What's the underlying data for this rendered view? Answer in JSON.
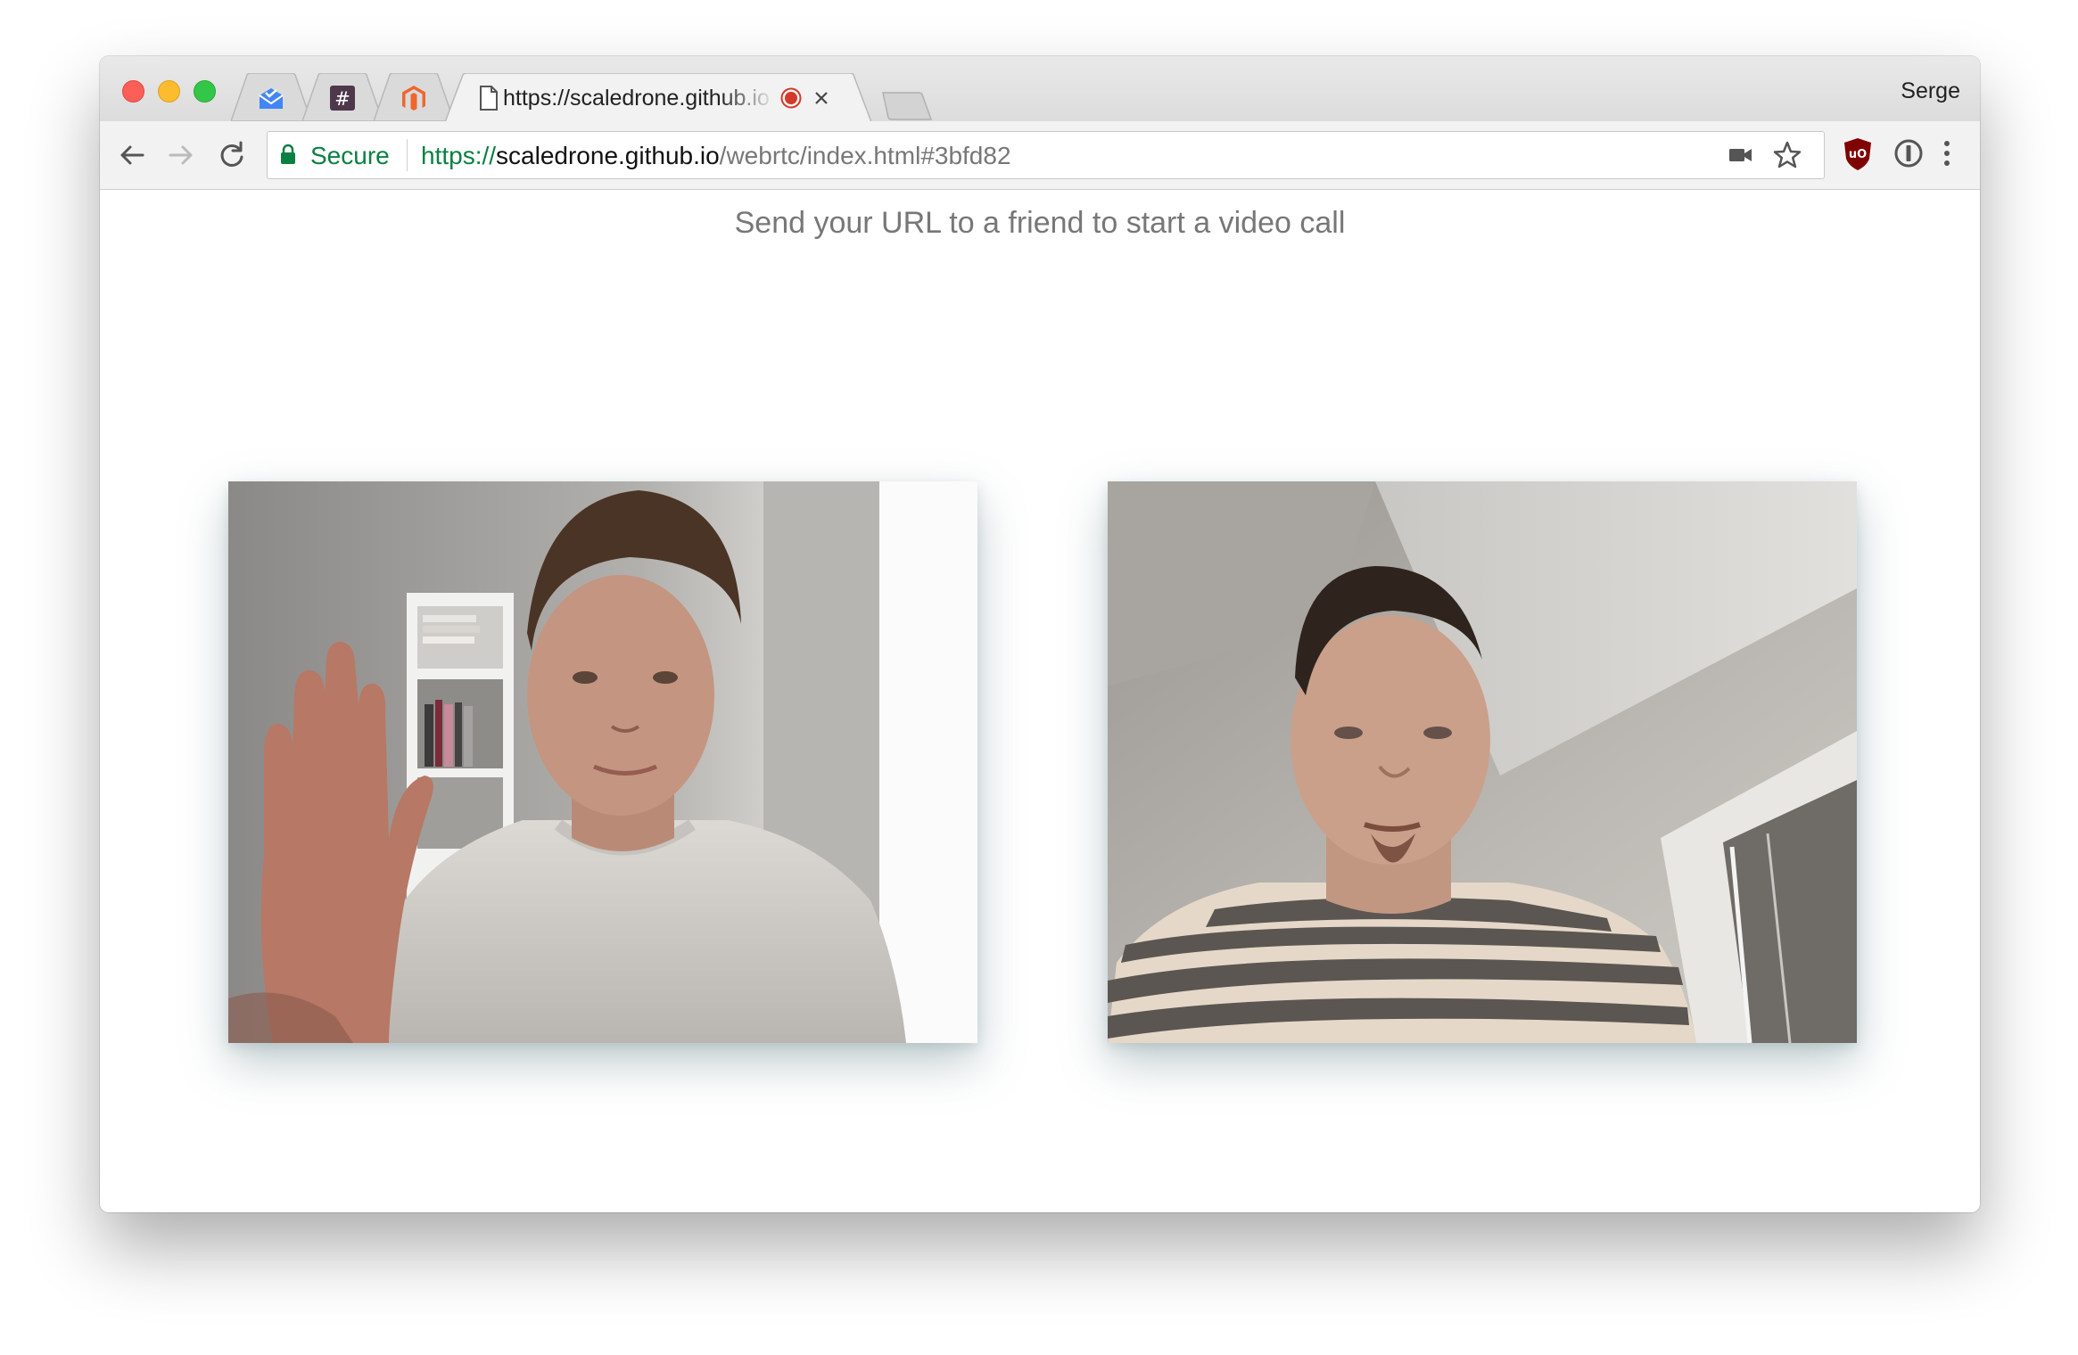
{
  "browser": {
    "profile_name": "Serge",
    "tabs": [
      {
        "icon": "inbox-envelope-icon",
        "pinned": true
      },
      {
        "icon": "slack-hash-icon",
        "pinned": true
      },
      {
        "icon": "magento-logo-icon",
        "pinned": true
      },
      {
        "title": "https://scaledrone.github.io",
        "icon": "page-icon",
        "recording": true,
        "active": true
      }
    ],
    "new_tab_label": ""
  },
  "toolbar": {
    "security_label": "Secure",
    "url": {
      "scheme": "https://",
      "host": "scaledrone.github.io",
      "path": "/webrtc/index.html#3bfd82"
    }
  },
  "page": {
    "heading": "Send your URL to a friend to start a video call"
  },
  "videos": {
    "local": {
      "description_icon": "video-feed-local"
    },
    "remote": {
      "description_icon": "video-feed-remote"
    }
  },
  "colors": {
    "secure_green": "#0b8043",
    "record_red": "#d23a2a",
    "ublock_red": "#800000"
  }
}
